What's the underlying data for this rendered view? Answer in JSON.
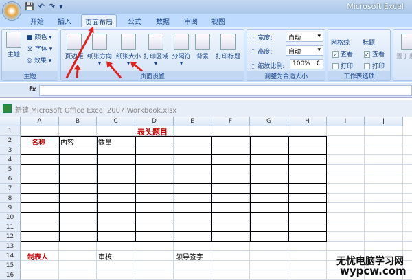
{
  "app": {
    "title": "Microsoft Excel",
    "workbook": "新建 Microsoft Office Excel 2007 Workbook.xlsx"
  },
  "tabs": [
    "开始",
    "插入",
    "页面布局",
    "公式",
    "数据",
    "审阅",
    "视图"
  ],
  "ribbon": {
    "theme": {
      "main": "主题",
      "colors": "颜色",
      "fonts": "字体",
      "effects": "效果",
      "group": "主题"
    },
    "page_setup": {
      "buttons": [
        "页边距",
        "纸张方向",
        "纸张大小",
        "打印区域",
        "分隔符",
        "背景",
        "打印标题"
      ],
      "group": "页面设置"
    },
    "scale": {
      "width_label": "宽度:",
      "width_value": "自动",
      "height_label": "高度:",
      "height_value": "自动",
      "zoom_label": "缩放比例:",
      "zoom_value": "100%",
      "group": "调整为合适大小"
    },
    "sheet_options": {
      "gridlines": "网格线",
      "headings": "标题",
      "view": "查看",
      "print": "打印",
      "group": "工作表选项",
      "gridlines_view": true,
      "gridlines_print": false,
      "headings_view": true,
      "headings_print": false
    },
    "arrange": {
      "bring_front": "置于顶层"
    }
  },
  "formula_bar": {
    "fx": "fx",
    "value": ""
  },
  "columns": [
    "A",
    "B",
    "C",
    "D",
    "E",
    "F",
    "G",
    "H",
    "I",
    "J"
  ],
  "rows": [
    "1",
    "2",
    "3",
    "4",
    "5",
    "6",
    "7",
    "8",
    "9",
    "10",
    "11",
    "12",
    "13",
    "14",
    "15",
    "16"
  ],
  "cells": {
    "title": "表头题目",
    "a2": "名称",
    "b2": "内容",
    "c2": "数量",
    "a14": "制表人",
    "c14": "审核",
    "e14": "领导签字"
  },
  "watermark": {
    "line1": "无忧电脑学习网",
    "line2": "wypcw.com"
  },
  "colors": {
    "accent_red": "#c00000",
    "arrow": "#e0201a"
  }
}
